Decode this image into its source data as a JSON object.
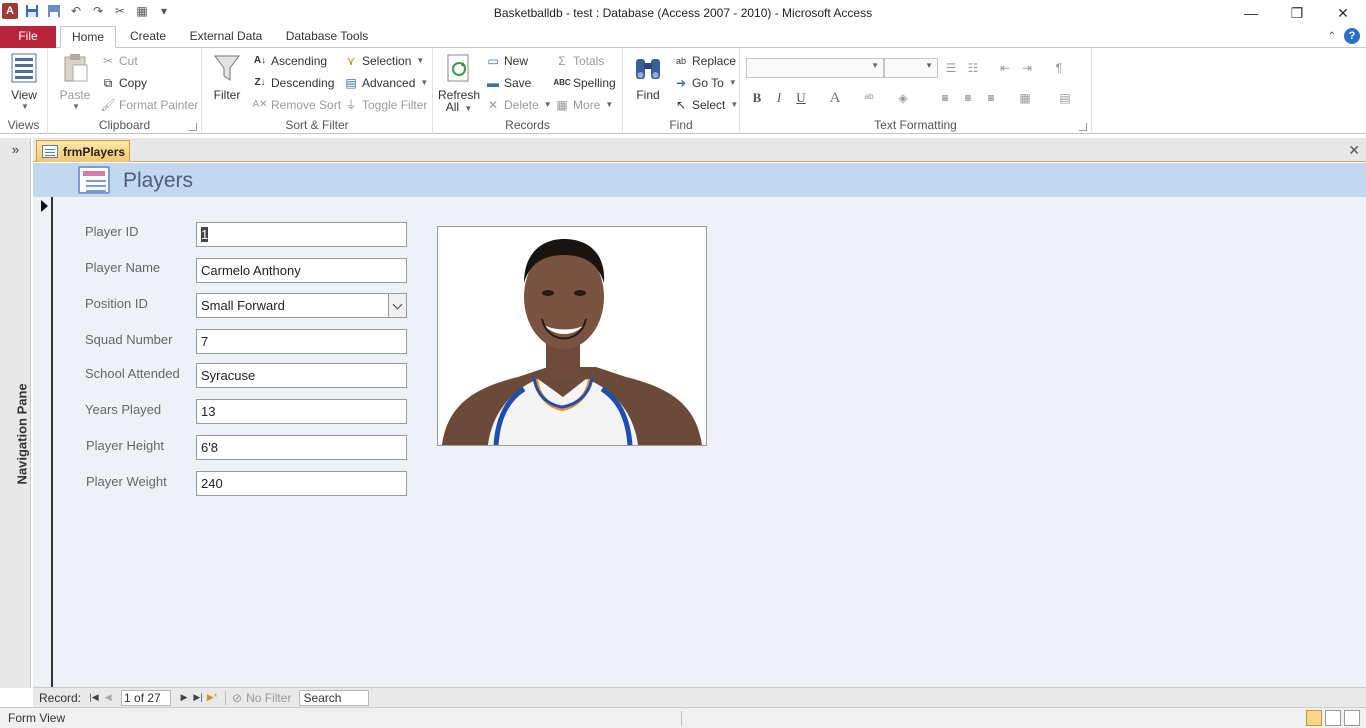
{
  "window": {
    "title": "Basketballdb - test : Database (Access 2007 - 2010)  -  Microsoft Access"
  },
  "ribbon_tabs": {
    "file": "File",
    "home": "Home",
    "create": "Create",
    "external_data": "External Data",
    "database_tools": "Database Tools"
  },
  "ribbon": {
    "views": {
      "label": "Views",
      "view": "View"
    },
    "clipboard": {
      "label": "Clipboard",
      "paste": "Paste",
      "cut": "Cut",
      "copy": "Copy",
      "format_painter": "Format Painter"
    },
    "sort_filter": {
      "label": "Sort & Filter",
      "filter": "Filter",
      "ascending": "Ascending",
      "descending": "Descending",
      "remove_sort": "Remove Sort",
      "selection": "Selection",
      "advanced": "Advanced",
      "toggle_filter": "Toggle Filter"
    },
    "records": {
      "label": "Records",
      "refresh_line1": "Refresh",
      "refresh_line2": "All",
      "new": "New",
      "save": "Save",
      "delete": "Delete",
      "totals": "Totals",
      "spelling": "Spelling",
      "more": "More"
    },
    "find": {
      "label": "Find",
      "find": "Find",
      "replace": "Replace",
      "go_to": "Go To",
      "select": "Select"
    },
    "text_formatting": {
      "label": "Text Formatting",
      "bold": "B",
      "italic": "I",
      "underline": "U",
      "font_color": "A"
    }
  },
  "nav_pane": {
    "label": "Navigation Pane",
    "expand": "»"
  },
  "document": {
    "tab_label": "frmPlayers",
    "form_title": "Players"
  },
  "form": {
    "fields": [
      {
        "label": "Player ID",
        "value": "1"
      },
      {
        "label": "Player Name",
        "value": "Carmelo Anthony"
      },
      {
        "label": "Position ID",
        "value": "Small Forward"
      },
      {
        "label": "Squad Number",
        "value": "7"
      },
      {
        "label": "School Attended",
        "value": "Syracuse"
      },
      {
        "label": "Years Played",
        "value": "13"
      },
      {
        "label": "Player Height",
        "value": "6'8"
      },
      {
        "label": "Player Weight",
        "value": "240"
      }
    ]
  },
  "record_nav": {
    "label": "Record:",
    "position": "1 of 27",
    "no_filter": "No Filter",
    "search": "Search"
  },
  "status_bar": {
    "text": "Form View"
  },
  "colors": {
    "file_tab": "#b9243d",
    "form_header": "#c2d8ee",
    "form_body": "#eef1f6",
    "doc_tab": "#f7c66c"
  }
}
